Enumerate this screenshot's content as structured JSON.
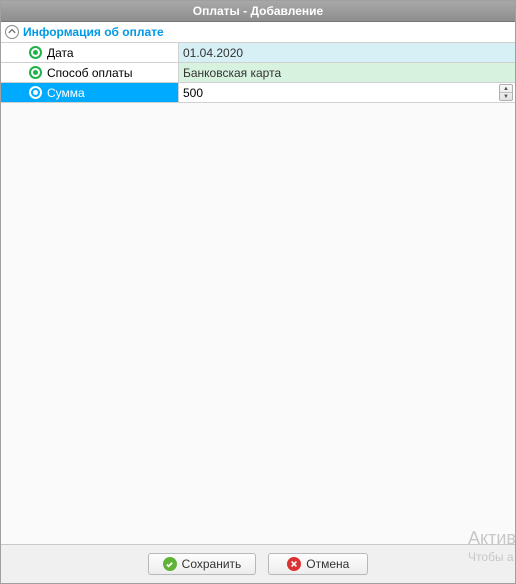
{
  "window": {
    "title": "Оплаты - Добавление"
  },
  "section": {
    "title": "Информация об оплате"
  },
  "fields": {
    "date": {
      "label": "Дата",
      "value": "01.04.2020"
    },
    "method": {
      "label": "Способ оплаты",
      "value": "Банковская карта"
    },
    "amount": {
      "label": "Сумма",
      "value": "500"
    }
  },
  "buttons": {
    "save": "Сохранить",
    "cancel": "Отмена"
  },
  "watermark": {
    "line1": "Актив",
    "line2": "Чтобы а"
  }
}
